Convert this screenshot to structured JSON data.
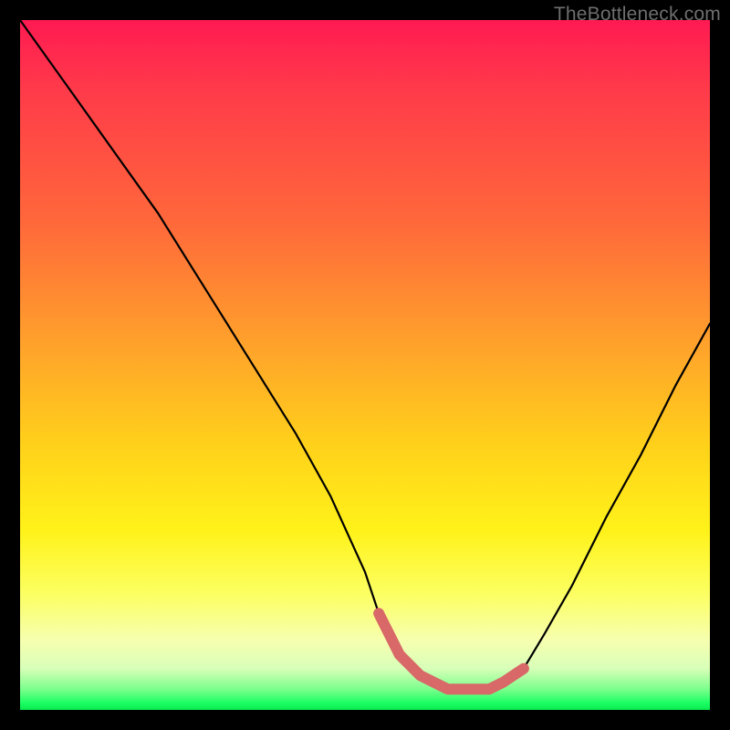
{
  "watermark": "TheBottleneck.com",
  "chart_data": {
    "type": "line",
    "title": "",
    "xlabel": "",
    "ylabel": "",
    "xlim": [
      0,
      100
    ],
    "ylim": [
      0,
      100
    ],
    "series": [
      {
        "name": "bottleneck-curve",
        "x": [
          0,
          5,
          10,
          15,
          20,
          25,
          30,
          35,
          40,
          45,
          50,
          52,
          55,
          58,
          62,
          65,
          68,
          70,
          73,
          76,
          80,
          85,
          90,
          95,
          100
        ],
        "values": [
          100,
          93,
          86,
          79,
          72,
          64,
          56,
          48,
          40,
          31,
          20,
          14,
          8,
          5,
          3,
          3,
          3,
          4,
          6,
          11,
          18,
          28,
          37,
          47,
          56
        ]
      }
    ],
    "highlight": {
      "name": "valley-marker",
      "x": [
        52,
        55,
        58,
        62,
        65,
        68,
        70,
        73
      ],
      "values": [
        14,
        8,
        5,
        3,
        3,
        3,
        4,
        6
      ],
      "color": "#d96868"
    },
    "gradient_stops": [
      {
        "pos": 0.0,
        "color": "#ff1a52"
      },
      {
        "pos": 0.3,
        "color": "#ff6a3a"
      },
      {
        "pos": 0.62,
        "color": "#ffd21a"
      },
      {
        "pos": 0.9,
        "color": "#f6ffb0"
      },
      {
        "pos": 1.0,
        "color": "#08e84e"
      }
    ]
  }
}
